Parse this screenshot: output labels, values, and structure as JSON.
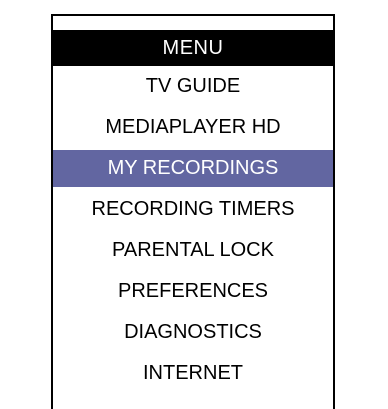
{
  "menu": {
    "title": "MENU",
    "selected_index": 2,
    "items": [
      {
        "label": "TV GUIDE"
      },
      {
        "label": "MEDIAPLAYER HD"
      },
      {
        "label": "MY RECORDINGS"
      },
      {
        "label": "RECORDING TIMERS"
      },
      {
        "label": "PARENTAL LOCK"
      },
      {
        "label": "PREFERENCES"
      },
      {
        "label": "DIAGNOSTICS"
      },
      {
        "label": "INTERNET"
      }
    ]
  },
  "colors": {
    "header_background": "#000000",
    "header_text": "#ffffff",
    "selected_background": "#6266a1",
    "selected_text": "#ffffff",
    "item_text": "#000000"
  }
}
